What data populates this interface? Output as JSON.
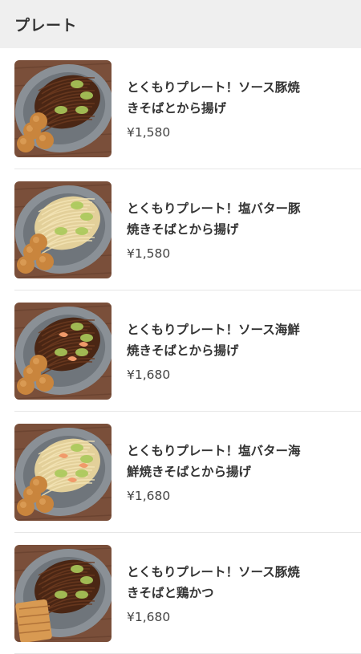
{
  "section": {
    "title": "プレート"
  },
  "items": [
    {
      "name_line1": "とくもりプレート！ソース豚焼",
      "name_line2": "きそばとから揚げ",
      "price": "¥1,580",
      "image": "sauce-yakisoba-karaage-plate"
    },
    {
      "name_line1": "とくもりプレート！塩バター豚",
      "name_line2": "焼きそばとから揚げ",
      "price": "¥1,580",
      "image": "shio-butter-yakisoba-karaage-plate"
    },
    {
      "name_line1": "とくもりプレート！ソース海鮮",
      "name_line2": "焼きそばとから揚げ",
      "price": "¥1,680",
      "image": "sauce-seafood-yakisoba-karaage-plate"
    },
    {
      "name_line1": "とくもりプレート！塩バター海",
      "name_line2": "鮮焼きそばとから揚げ",
      "price": "¥1,680",
      "image": "shio-butter-seafood-yakisoba-karaage-plate"
    },
    {
      "name_line1": "とくもりプレート！ソース豚焼",
      "name_line2": "きそばと鶏かつ",
      "price": "¥1,680",
      "image": "sauce-yakisoba-chicken-katsu-plate"
    }
  ],
  "colors": {
    "header_bg": "#efefef",
    "wood": "#7a4f3a",
    "plate": "#8a9096",
    "sauce_noodle": "#4a2614",
    "salt_noodle": "#e3d09a",
    "karaage": "#c9853d",
    "cabbage": "#a9c95a"
  }
}
